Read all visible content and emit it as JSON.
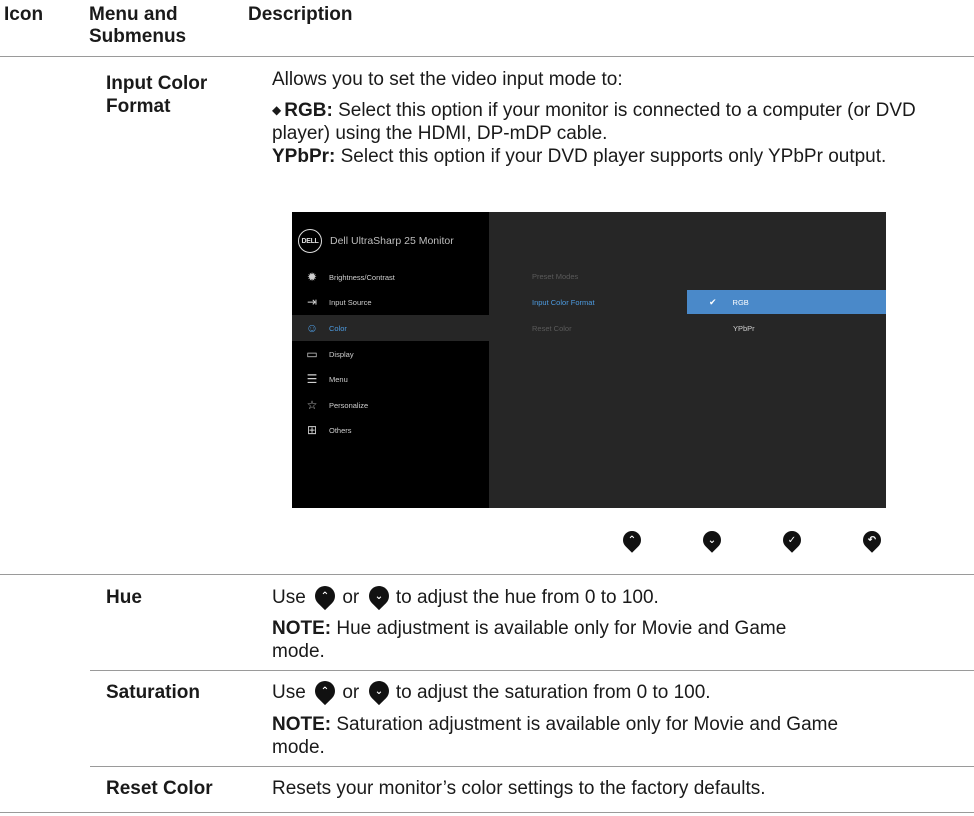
{
  "header": {
    "icon": "Icon",
    "menu": "Menu and Submenus",
    "description": "Description"
  },
  "rows": {
    "input_color_format": {
      "label": "Input Color Format",
      "intro": "Allows you to set the video input mode to:",
      "rgb_term": "RGB:",
      "rgb_text": " Select this option if your monitor is connected to a computer (or DVD player) using the HDMI, DP-mDP cable.",
      "ypbpr_term": "YPbPr:",
      "ypbpr_text": " Select this option if your DVD player supports only YPbPr output."
    },
    "hue": {
      "label": "Hue",
      "use": "Use",
      "or": "or",
      "text": "to adjust the hue from 0 to 100.",
      "note_term": "NOTE:",
      "note_text": " Hue adjustment is available only for Movie and Game mode."
    },
    "saturation": {
      "label": "Saturation",
      "use": "Use",
      "or": "or",
      "text": "to adjust the saturation from 0 to 100.",
      "note_term": "NOTE:",
      "note_text": " Saturation adjustment is available only for Movie and Game mode."
    },
    "reset_color": {
      "label": "Reset Color",
      "text": "Resets your monitor’s color settings to the factory defaults."
    }
  },
  "osd": {
    "logo": "DELL",
    "title": "Dell UltraSharp 25 Monitor",
    "menu": [
      {
        "label": "Brightness/Contrast",
        "icon": "sun-icon"
      },
      {
        "label": "Input Source",
        "icon": "input-source-icon"
      },
      {
        "label": "Color",
        "icon": "palette-icon"
      },
      {
        "label": "Display",
        "icon": "monitor-icon"
      },
      {
        "label": "Menu",
        "icon": "menu-list-icon"
      },
      {
        "label": "Personalize",
        "icon": "star-icon"
      },
      {
        "label": "Others",
        "icon": "others-icon"
      }
    ],
    "selected_menu": "Color",
    "submenu": [
      "Preset Modes",
      "Input Color Format",
      "Reset Color"
    ],
    "options": [
      "RGB",
      "YPbPr"
    ],
    "selected_option": "RGB",
    "accent_color": "#4a89c9"
  },
  "buttons": [
    "up-arrow-icon",
    "down-arrow-icon",
    "check-icon",
    "back-icon"
  ]
}
